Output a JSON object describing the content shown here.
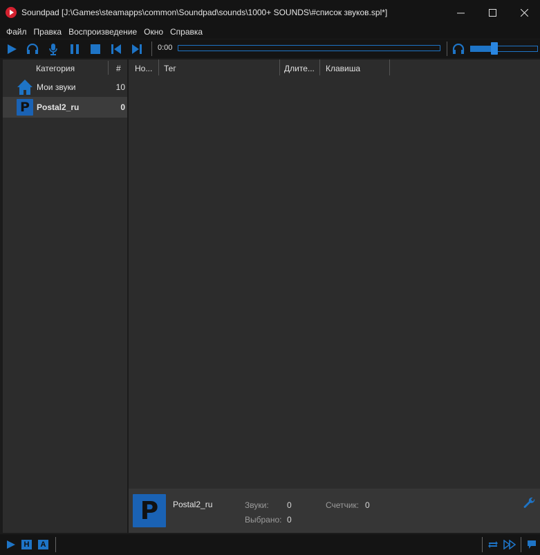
{
  "window": {
    "title": "Soundpad [J:\\Games\\steamapps\\common\\Soundpad\\sounds\\1000+ SOUNDS\\#список звуков.spl*]",
    "controls": {
      "minimize": "—",
      "maximize": "☐",
      "close": "✕"
    }
  },
  "menu": [
    "Файл",
    "Правка",
    "Воспроизведение",
    "Окно",
    "Справка"
  ],
  "toolbar": {
    "icons": [
      "play-icon",
      "headphones-icon",
      "microphone-icon",
      "pause-icon",
      "stop-icon",
      "previous-icon",
      "next-icon"
    ],
    "time": "0:00",
    "progress": 0,
    "volume": 0.36,
    "accent": "#1e74c6"
  },
  "sidebar": {
    "header": {
      "category": "Категория",
      "count": "#"
    },
    "items": [
      {
        "label": "Мои звуки",
        "count": "10",
        "icon": "home-icon",
        "selected": false
      },
      {
        "label": "Postal2_ru",
        "count": "0",
        "icon": "p-badge-icon",
        "badge_letter": "P",
        "selected": true
      }
    ]
  },
  "list": {
    "columns": [
      "Но...",
      "Тег",
      "Длите...",
      "Клавиша"
    ],
    "rows": []
  },
  "info": {
    "badge_letter": "P",
    "name": "Postal2_ru",
    "sounds_label": "Звуки:",
    "sounds_value": "0",
    "counter_label": "Счетчик:",
    "counter_value": "0",
    "selected_label": "Выбрано:",
    "selected_value": "0"
  },
  "status": {
    "h_label": "H",
    "a_label": "A"
  }
}
